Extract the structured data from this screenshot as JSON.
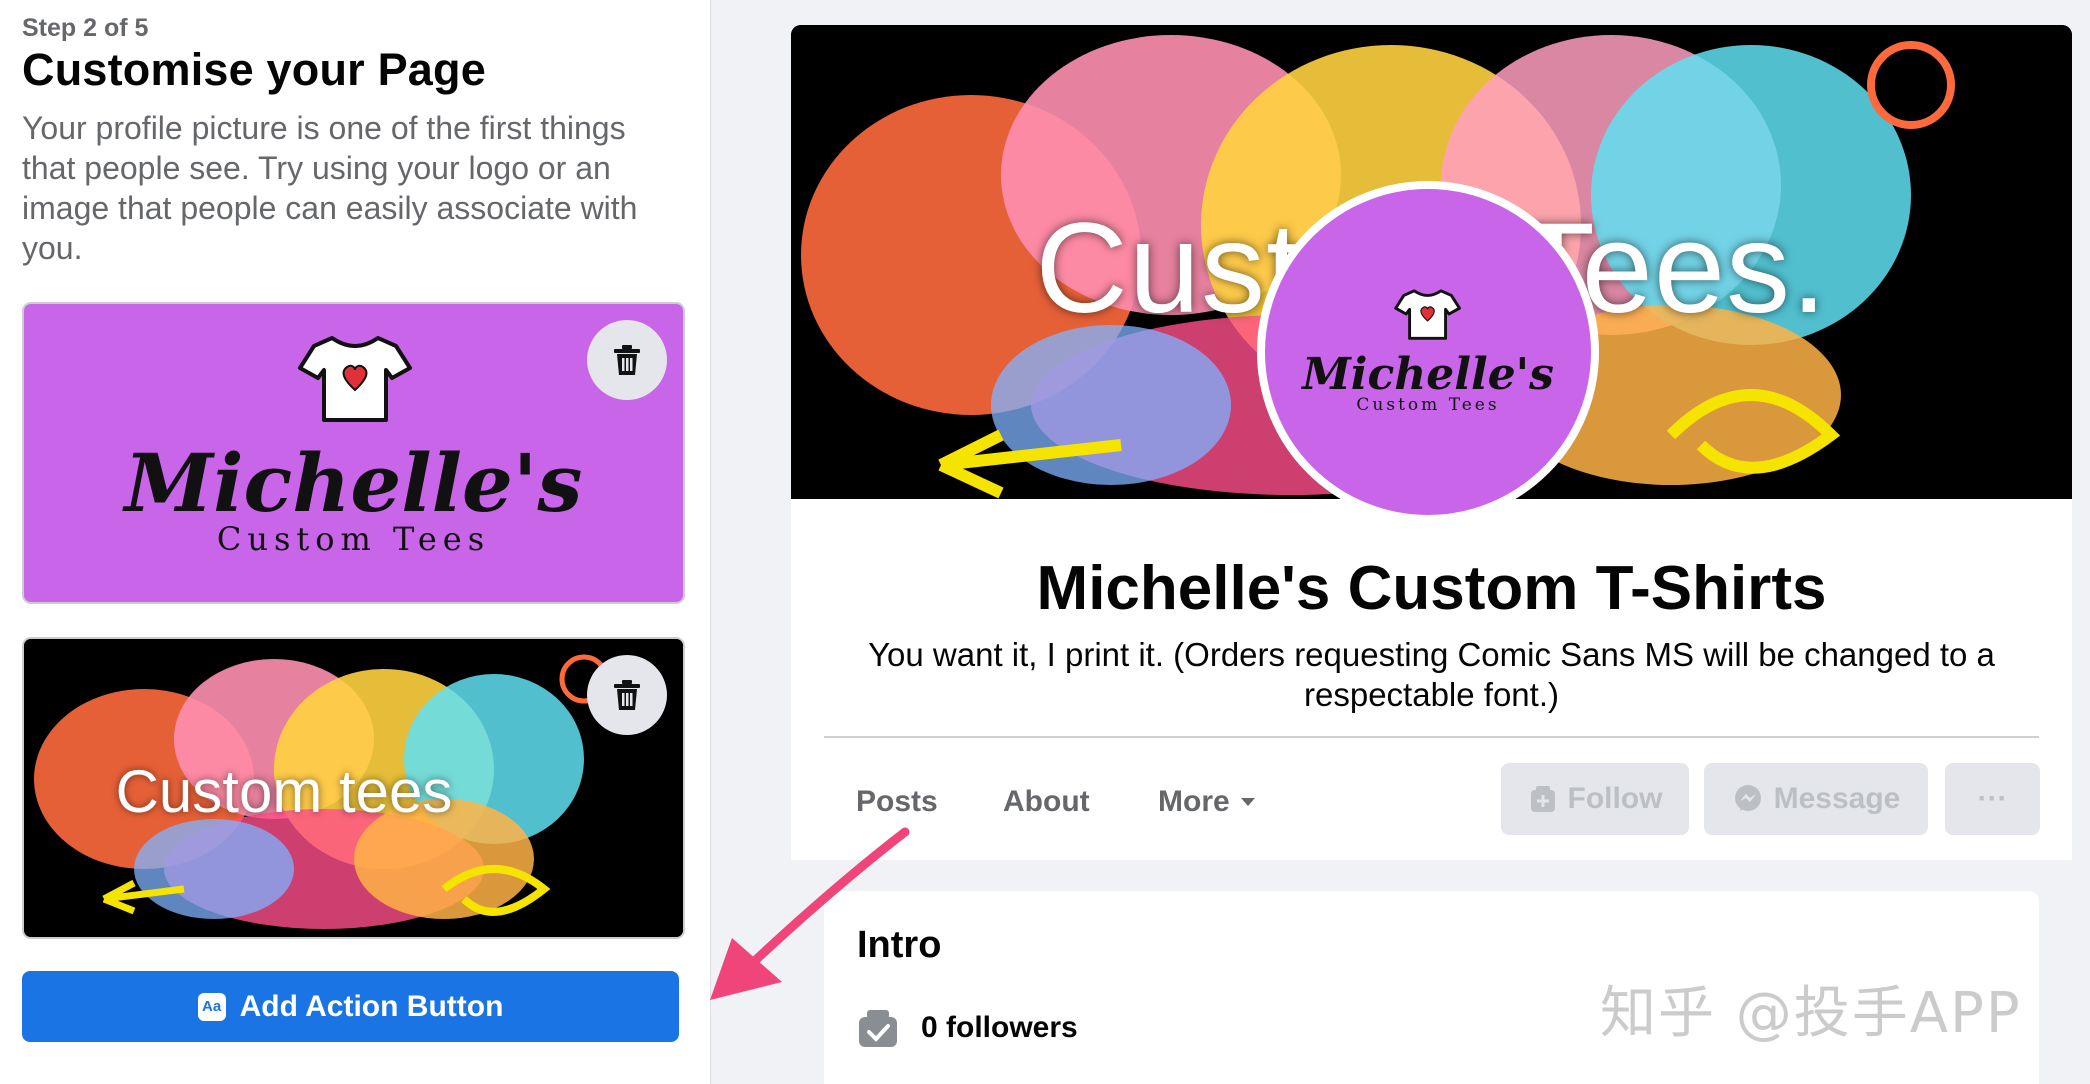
{
  "wizard": {
    "step": "Step 2 of 5",
    "heading": "Customise your Page",
    "description": "Your profile picture is one of the first things that people see. Try using your logo or an image that people can easily associate with you.",
    "profile_logo_title": "Michelle's",
    "profile_logo_subtitle": "Custom Tees",
    "cover_text": "Custom tees",
    "add_action_label": "Add Action Button",
    "add_action_icon": "Aa"
  },
  "preview": {
    "cover_text": "Custom Tees.",
    "page_name": "Michelle's Custom T-Shirts",
    "bio": "You want it, I print it. (Orders requesting Comic Sans MS will be changed to a respectable font.)",
    "tabs": [
      "Posts",
      "About",
      "More"
    ],
    "buttons": {
      "follow": "Follow",
      "message": "Message",
      "more": "···"
    },
    "intro": {
      "title": "Intro",
      "followers": "0 followers"
    }
  },
  "watermark": "知乎 @投手APP",
  "colors": {
    "brand_purple": "#c865e8",
    "fb_blue": "#1b74e4",
    "arrow_pink": "#f0457a"
  }
}
